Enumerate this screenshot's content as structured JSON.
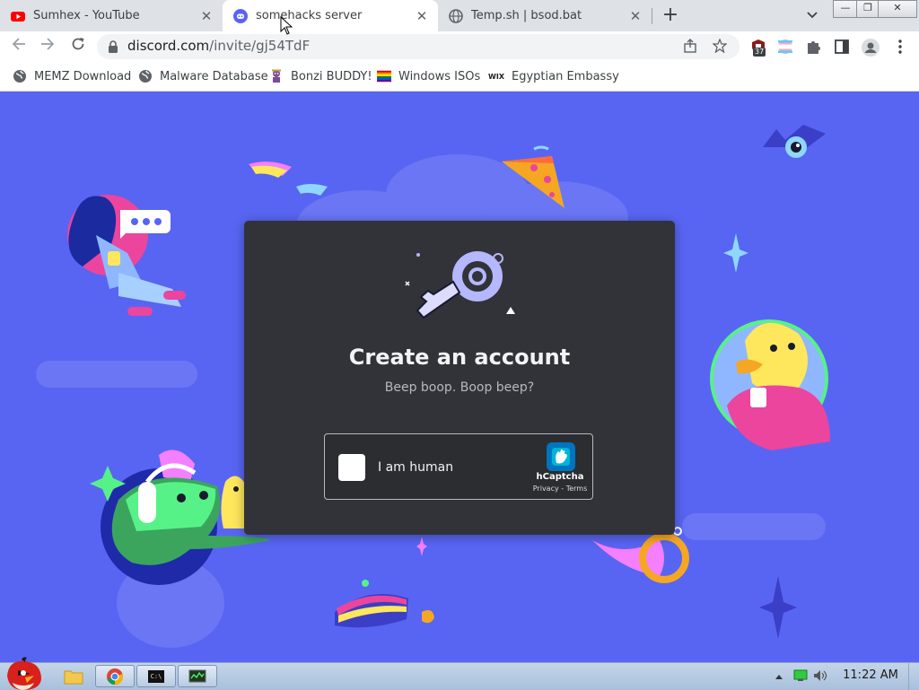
{
  "tabs": [
    {
      "title": "Sumhex - YouTube",
      "favicon": "youtube-icon"
    },
    {
      "title": "somehacks server",
      "favicon": "discord-icon",
      "active": true
    },
    {
      "title": "Temp.sh | bsod.bat",
      "favicon": "globe-icon"
    }
  ],
  "tab_close_glyph": "✕",
  "new_tab_glyph": "+",
  "window_controls": {
    "minimize": "—",
    "maximize": "❐",
    "close": "✕"
  },
  "toolbar": {
    "url_host": "discord.com",
    "url_path": "/invite/gj54TdF",
    "extension_badge": "37"
  },
  "bookmarks": [
    {
      "label": "MEMZ Download",
      "icon": "globe-icon"
    },
    {
      "label": "Malware Database",
      "icon": "globe-icon"
    },
    {
      "label": "Bonzi BUDDY!",
      "icon": "bonzi-icon"
    },
    {
      "label": "Windows ISOs",
      "icon": "rainbow-flag-icon"
    },
    {
      "label": "Egyptian Embassy",
      "icon": "wix-icon"
    }
  ],
  "bookmark_wix_text": "WIX",
  "card": {
    "title": "Create an account",
    "subtitle": "Beep boop. Boop beep?"
  },
  "captcha": {
    "label": "I am human",
    "brand": "hCaptcha",
    "links": "Privacy - Terms"
  },
  "taskbar": {
    "time": "11:22 AM",
    "cmd_label": "C:\\"
  },
  "colors": {
    "background": "#5865f2",
    "card": "#313338",
    "captcha_bg": "#2b2d31"
  }
}
